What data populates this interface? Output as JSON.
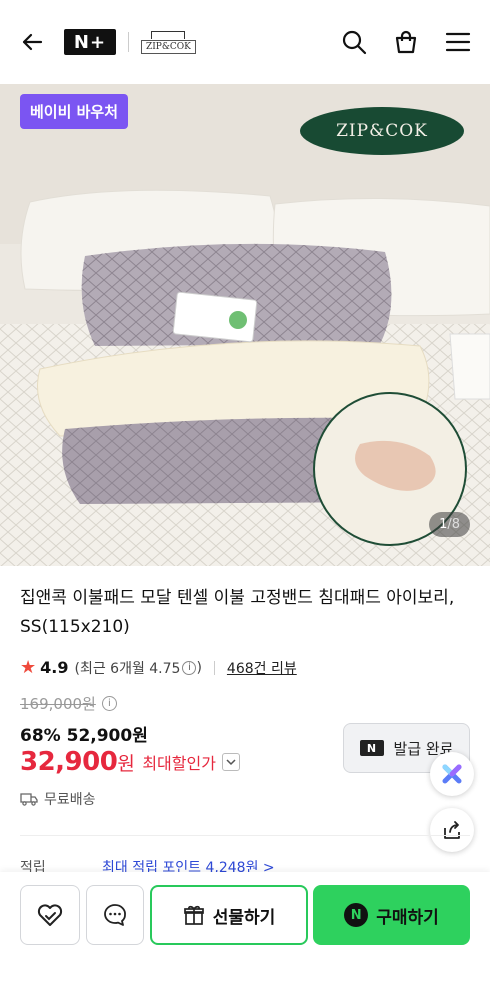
{
  "header": {
    "back_icon": "arrow-left-icon",
    "nplus_logo": "N+",
    "brand_mini_logo": "ZIP&COK",
    "icons": [
      "search-icon",
      "shopping-bag-icon",
      "menu-icon"
    ]
  },
  "hero": {
    "voucher_badge": "베이비 바우처",
    "brand_logo": "ZIP&COK",
    "counter_current": "1",
    "counter_total": "/8"
  },
  "product": {
    "title": "집앤콕 이불패드 모달 텐셀 이불 고정밴드 침대패드 아이보리, SS(115x210)",
    "rating_score": "4.9",
    "rating_recent": "(최근 6개월 4.75",
    "rating_close": ")",
    "review_count": "468건 리뷰",
    "original_price": "169,000원",
    "discount_line": "68% 52,900원",
    "max_price": "32,900",
    "max_price_unit": "원",
    "max_discount_label": "최대할인가",
    "coupon_button": "발급 완료",
    "coupon_badge": "N",
    "shipping": "무료배송",
    "points_label": "적립",
    "points_value": "최대 적립 포인트 4,248원 >"
  },
  "bottom_bar": {
    "gift_label": "선물하기",
    "buy_label": "구매하기",
    "buy_badge": "N"
  },
  "colors": {
    "voucher_bg": "#7b55f2",
    "price_red": "#e6283e",
    "naver_green": "#2ed15e",
    "points_blue": "#2e49d6",
    "brand_green": "#184a33"
  }
}
